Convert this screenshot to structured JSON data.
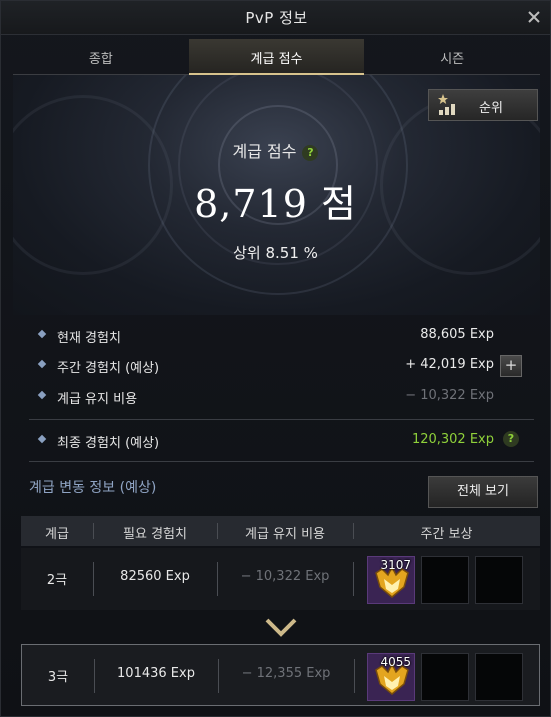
{
  "window": {
    "title": "PvP 정보"
  },
  "tabs": [
    {
      "label": "종합"
    },
    {
      "label": "계급 점수"
    },
    {
      "label": "시즌"
    }
  ],
  "rank_button": {
    "label": "순위"
  },
  "score": {
    "title": "계급 점수",
    "help": "?",
    "value": "8,719 점",
    "percentile": "상위 8.51 %"
  },
  "exp": {
    "current": {
      "label": "현재 경험치",
      "value": "88,605 Exp"
    },
    "weekly": {
      "label": "주간 경험치 (예상)",
      "value": "+ 42,019 Exp",
      "plus": "+"
    },
    "upkeep": {
      "label": "계급 유지 비용",
      "value": "− 10,322 Exp"
    },
    "final": {
      "label": "최종 경험치 (예상)",
      "value": "120,302 Exp",
      "help": "?"
    }
  },
  "tier_section": {
    "title": "계급 변동 정보 (예상)",
    "view_all": "전체 보기"
  },
  "table": {
    "headers": [
      "계급",
      "필요 경험치",
      "계급 유지 비용",
      "주간 보상"
    ],
    "rows": [
      {
        "tier": "2극",
        "required": "82560 Exp",
        "upkeep": "− 10,322 Exp",
        "reward_count": "3107"
      },
      {
        "tier": "3극",
        "required": "101436 Exp",
        "upkeep": "− 12,355 Exp",
        "reward_count": "4055"
      }
    ]
  },
  "colors": {
    "accent_gold": "#d7c38d",
    "positive_green": "#8fd13a",
    "section_blue": "#8fa4c4",
    "reward_purple": "#3a2453"
  },
  "icons": [
    "close-icon",
    "rank-chart-icon",
    "help-icon",
    "plus-icon",
    "chevron-down-icon",
    "reward-emblem-icon"
  ]
}
